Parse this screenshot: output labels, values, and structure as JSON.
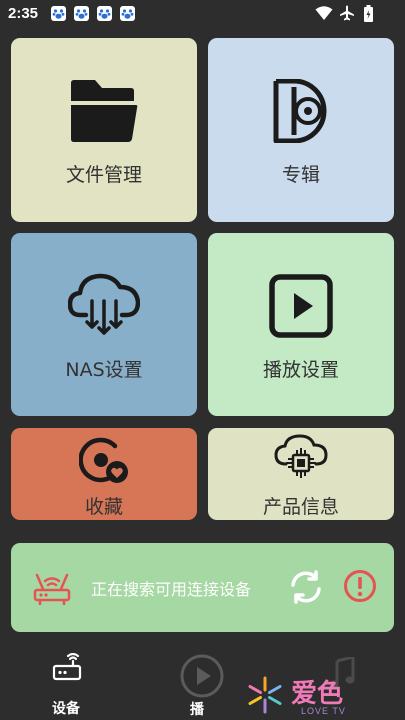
{
  "status_bar": {
    "time": "2:35",
    "notification_icons": [
      "baidu-paw-icon",
      "baidu-paw-icon",
      "baidu-paw-icon",
      "baidu-paw-icon"
    ],
    "system_icons": [
      "wifi-icon",
      "airplane-icon",
      "battery-icon"
    ]
  },
  "tiles": {
    "files": {
      "label": "文件管理",
      "icon": "folder-icon",
      "color": "#e1e3c2"
    },
    "album": {
      "label": "专辑",
      "icon": "disc-icon",
      "color": "#c9dbed"
    },
    "nas": {
      "label": "NAS设置",
      "icon": "cloud-download-icon",
      "color": "#88afc9"
    },
    "play": {
      "label": "播放设置",
      "icon": "play-icon",
      "color": "#c4e9c5"
    },
    "favorites": {
      "label": "收藏",
      "icon": "heart-disc-icon",
      "color": "#d67657"
    },
    "product_info": {
      "label": "产品信息",
      "icon": "cloud-chip-icon",
      "color": "#e0e3c3"
    }
  },
  "connection": {
    "status_text": "正在搜索可用连接设备",
    "color": "#a5d8a2",
    "accent": "#e55353"
  },
  "bottom_nav": {
    "items": [
      {
        "label": "设备",
        "icon": "router-icon"
      },
      {
        "label": "播",
        "icon": "play-circle-icon"
      },
      {
        "label": "",
        "icon": "music-note-icon"
      }
    ]
  },
  "watermark": {
    "text": "爱色",
    "subtext": "LOVE TV"
  }
}
